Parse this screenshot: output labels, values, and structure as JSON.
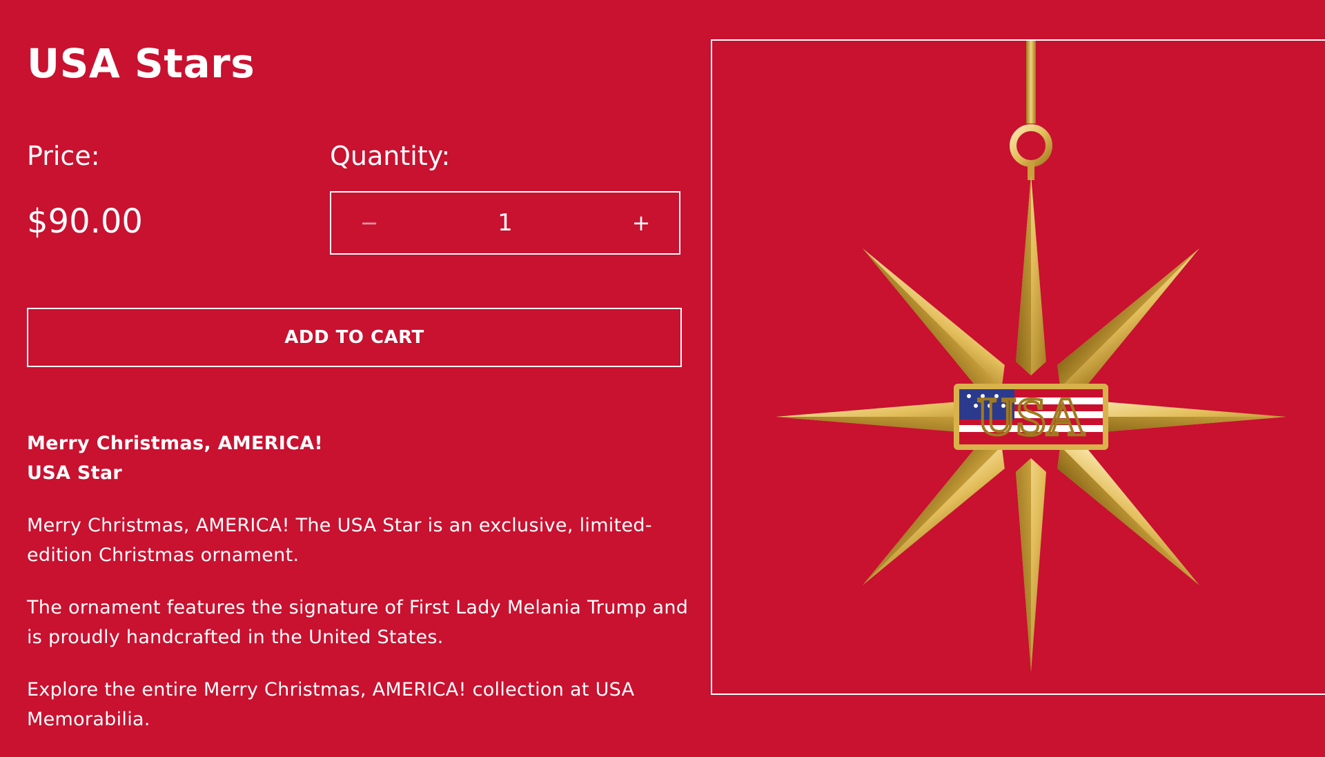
{
  "product": {
    "title": "USA Stars",
    "price_label": "Price:",
    "price": "$90.00",
    "quantity_label": "Quantity:",
    "quantity": "1",
    "decrement_symbol": "−",
    "increment_symbol": "+",
    "add_to_cart": "ADD TO CART"
  },
  "description": {
    "heading_line1": "Merry Christmas, AMERICA!",
    "heading_line2": "USA Star",
    "paragraphs": [
      "Merry Christmas, AMERICA! The USA Star is an exclusive, limited-edition Christmas ornament.",
      "The ornament features the signature of First Lady Melania Trump and is proudly handcrafted in the United States.",
      "Explore the entire Merry Christmas, AMERICA! collection at USA Memorabilia."
    ]
  },
  "image": {
    "subject": "gold-eight-point-star-ornament",
    "center_lettering": "USA",
    "colors": {
      "background": "#c91130",
      "gold_light": "#f6dd93",
      "gold_mid": "#d9b24c",
      "gold_dark": "#a07a1f",
      "flag_blue": "#2b3a8c",
      "flag_red": "#c8102e"
    }
  }
}
